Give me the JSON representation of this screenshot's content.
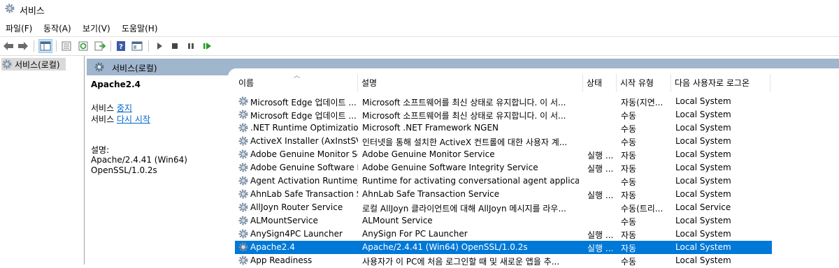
{
  "window": {
    "title": "서비스"
  },
  "menu": [
    "파일(F)",
    "동작(A)",
    "보기(V)",
    "도움말(H)"
  ],
  "toolbar": {
    "icons": [
      "back-arrow-icon",
      "forward-arrow-icon",
      "show-tree-icon",
      "properties-icon",
      "refresh-icon",
      "export-icon",
      "help-icon",
      "console-icon",
      "play-icon",
      "stop-icon",
      "pause-icon",
      "restart-icon"
    ]
  },
  "tree": {
    "root_label": "서비스(로컬)"
  },
  "header": {
    "label": "서비스(로컬)"
  },
  "detail": {
    "service_name": "Apache2.4",
    "stop_prefix": "서비스 ",
    "stop_link": "중지",
    "restart_prefix": "서비스 ",
    "restart_link": "다시 시작",
    "desc_label": "설명:",
    "desc_line1": "Apache/2.4.41 (Win64)",
    "desc_line2": "OpenSSL/1.0.2s"
  },
  "columns": [
    "이름",
    "설명",
    "상태",
    "시작 유형",
    "다음 사용자로 로그온"
  ],
  "rows": [
    {
      "name": "Microsoft Edge 업데이트 ...",
      "desc": "Microsoft 소프트웨어를 최신 상태로 유지합니다. 이 서...",
      "status": "",
      "startup": "자동(지연...",
      "logon": "Local System"
    },
    {
      "name": "Microsoft Edge 업데이트 ...",
      "desc": "Microsoft 소프트웨어를 최신 상태로 유지합니다. 이 서...",
      "status": "",
      "startup": "수동",
      "logon": "Local System"
    },
    {
      "name": ".NET Runtime Optimization...",
      "desc": "Microsoft .NET Framework NGEN",
      "status": "",
      "startup": "수동",
      "logon": "Local System"
    },
    {
      "name": "ActiveX Installer (AxInstSV)",
      "desc": "인터넷을 통해 설치한 ActiveX 컨트롤에 대한 사용자 계...",
      "status": "",
      "startup": "수동",
      "logon": "Local System"
    },
    {
      "name": "Adobe Genuine Monitor Se...",
      "desc": "Adobe Genuine Monitor Service",
      "status": "실행 ...",
      "startup": "자동",
      "logon": "Local System"
    },
    {
      "name": "Adobe Genuine Software I...",
      "desc": "Adobe Genuine Software Integrity Service",
      "status": "실행 ...",
      "startup": "자동",
      "logon": "Local System"
    },
    {
      "name": "Agent Activation Runtime_...",
      "desc": "Runtime for activating conversational agent applications",
      "status": "",
      "startup": "수동",
      "logon": "Local System"
    },
    {
      "name": "AhnLab Safe Transaction S...",
      "desc": "AhnLab Safe Transaction Service",
      "status": "실행 ...",
      "startup": "자동",
      "logon": "Local System"
    },
    {
      "name": "AllJoyn Router Service",
      "desc": "로컬 AllJoyn 클라이언트에 대해 AllJoyn 메시지를 라우...",
      "status": "",
      "startup": "수동(트리...",
      "logon": "Local Service"
    },
    {
      "name": "ALMountService",
      "desc": "ALMount Service",
      "status": "",
      "startup": "수동",
      "logon": "Local System"
    },
    {
      "name": "AnySign4PC Launcher",
      "desc": "AnySign For PC Launcher",
      "status": "실행 ...",
      "startup": "자동",
      "logon": "Local System"
    },
    {
      "name": "Apache2.4",
      "desc": "Apache/2.4.41 (Win64) OpenSSL/1.0.2s",
      "status": "실행 ...",
      "startup": "자동",
      "logon": "Local System",
      "selected": true
    },
    {
      "name": "App Readiness",
      "desc": "사용자가 이 PC에 처음 로그인할 때 및 새로운 앱을 추...",
      "status": "",
      "startup": "수동",
      "logon": "Local System"
    }
  ]
}
